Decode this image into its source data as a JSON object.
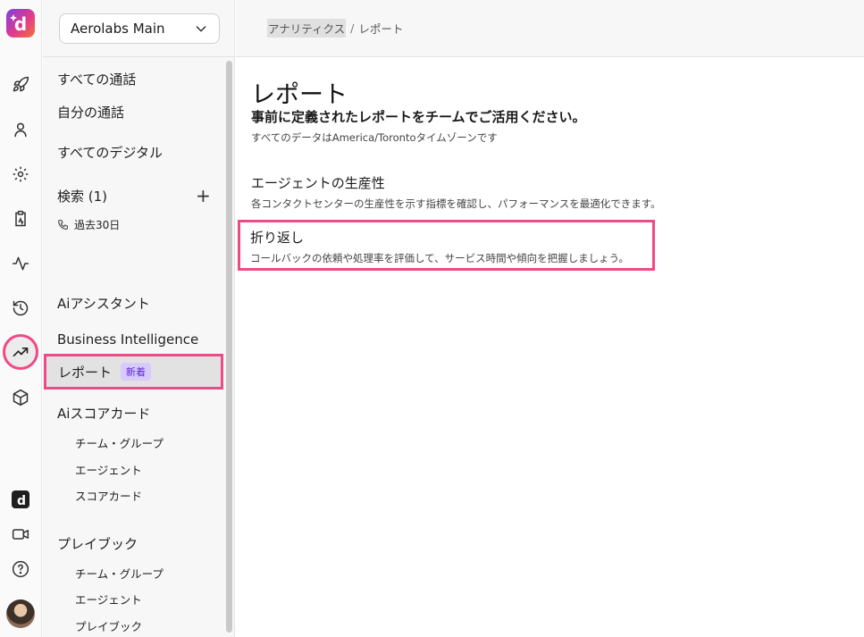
{
  "colors": {
    "highlight": "#f04a86",
    "badge_bg": "#d8c9ff",
    "badge_text": "#5b2bc8"
  },
  "rail": {
    "icons": [
      "rocket-icon",
      "person-icon",
      "gear-icon",
      "clipboard-icon",
      "activity-icon",
      "history-icon",
      "trending-up-icon",
      "cube-icon",
      "app-logo-icon",
      "video-icon",
      "help-icon"
    ],
    "active": "trending-up-icon"
  },
  "sidebar": {
    "workspace": "Aerolabs Main",
    "items": {
      "all_calls": "すべての通話",
      "my_calls": "自分の通話",
      "all_digital": "すべてのデジタル",
      "search": "検索 (1)",
      "search_filter": "過去30日",
      "ai_assistant": "Aiアシスタント",
      "business_intelligence": "Business Intelligence",
      "reports": "レポート",
      "reports_badge": "新着",
      "ai_scorecard": "Aiスコアカード",
      "scorecard_team": "チーム・グループ",
      "scorecard_agent": "エージェント",
      "scorecard_scorecard": "スコアカード",
      "playbook": "プレイブック",
      "playbook_team": "チーム・グループ",
      "playbook_agent": "エージェント",
      "playbook_playbook": "プレイブック"
    }
  },
  "breadcrumb": {
    "parent": "アナリティクス",
    "separator": "/",
    "current": "レポート"
  },
  "main": {
    "title": "レポート",
    "subtitle": "事前に定義されたレポートをチームでご活用ください。",
    "timezone_note": "すべてのデータはAmerica/Torontoタイムゾーンです",
    "reports": [
      {
        "title": "エージェントの生産性",
        "description": "各コンタクトセンターの生産性を示す指標を確認し、パフォーマンスを最適化できます。"
      },
      {
        "title": "折り返し",
        "description": "コールバックの依頼や処理率を評価して、サービス時間や傾向を把握しましょう。"
      }
    ]
  }
}
